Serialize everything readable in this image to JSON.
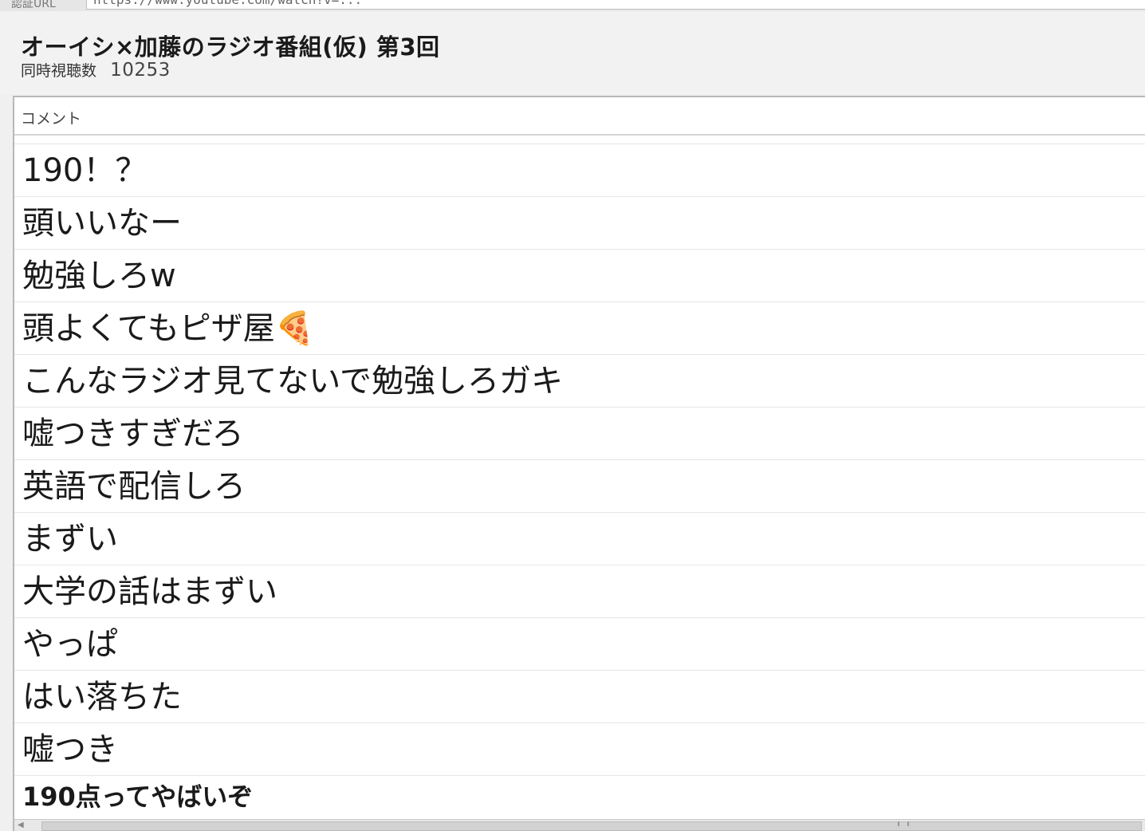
{
  "browser": {
    "url_label": "認証URL",
    "url": "https://www.youtube.com/watch?v=..."
  },
  "header": {
    "title": "オーイシ×加藤のラジオ番組(仮) 第3回",
    "viewers_label": "同時視聴数",
    "viewers_value": "10253"
  },
  "comments": {
    "column_header": "コメント",
    "items": [
      "190！？",
      "頭いいなー",
      "勉強しろw",
      "頭よくてもピザ屋🍕",
      "こんなラジオ見てないで勉強しろガキ",
      "嘘つきすぎだろ",
      "英語で配信しろ",
      "まずい",
      "大学の話はまずい",
      "やっぱ",
      "はい落ちた",
      "嘘つき",
      "190点ってやばいぞ"
    ]
  },
  "colors": {
    "panel_bg": "#ffffff",
    "window_bg": "#f0f0f0",
    "row_divider": "#e6e6e6",
    "text": "#1a1a1a"
  }
}
